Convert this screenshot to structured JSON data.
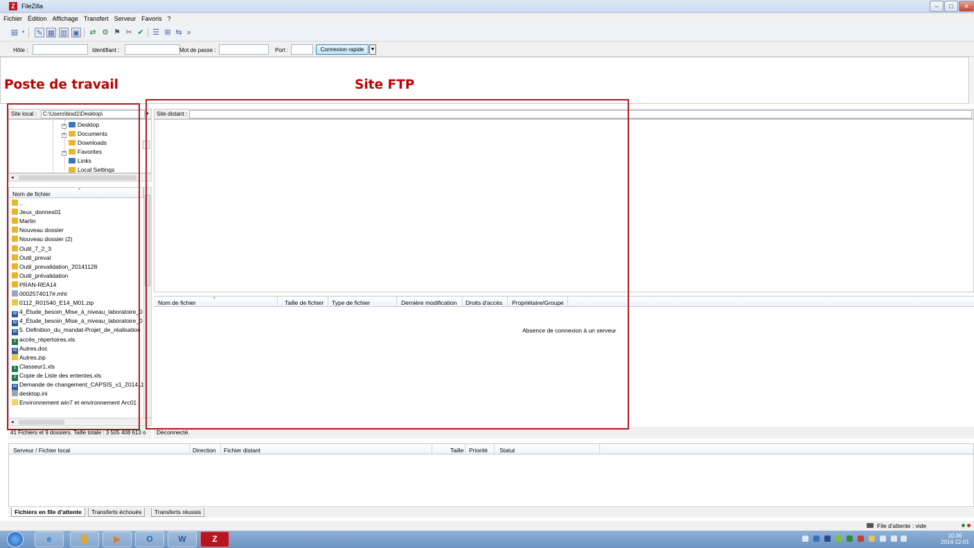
{
  "window": {
    "title": "FileZilla",
    "app_icon": "Z"
  },
  "menu": [
    "Fichier",
    "Édition",
    "Affichage",
    "Transfert",
    "Serveur",
    "Favoris",
    "?"
  ],
  "toolbar_icons": [
    "site-manager-icon",
    "dropdown-icon",
    "toggle-log-icon",
    "toggle-local-tree-icon",
    "toggle-remote-tree-icon",
    "toggle-queue-icon",
    "refresh-icon",
    "process-queue-icon",
    "cancel-icon",
    "disconnect-icon",
    "reconnect-icon",
    "filter-icon",
    "compare-icon",
    "sync-browse-icon",
    "search-icon"
  ],
  "quickconnect": {
    "host_label": "Hôte :",
    "user_label": "Identifiant :",
    "pass_label": "Mot de passe :",
    "port_label": "Port :",
    "button": "Connexion rapide",
    "arrow": "▼"
  },
  "overlays": {
    "local": "Poste de travail",
    "remote": "Site FTP"
  },
  "local": {
    "site_label": "Site local :",
    "path": "C:\\Users\\bisd1\\Desktop\\",
    "tree": [
      {
        "label": "Desktop",
        "expander": "+"
      },
      {
        "label": "Documents",
        "expander": "+"
      },
      {
        "label": "Downloads",
        "expander": ""
      },
      {
        "label": "Favorites",
        "expander": "+"
      },
      {
        "label": "Links",
        "expander": ""
      },
      {
        "label": "Local Settings",
        "expander": ""
      }
    ],
    "column": "Nom de fichier",
    "files": [
      {
        "name": "..",
        "type": "folder"
      },
      {
        "name": "Jeux_donnes01",
        "type": "folder"
      },
      {
        "name": "Martin",
        "type": "folder"
      },
      {
        "name": "Nouveau dossier",
        "type": "folder"
      },
      {
        "name": "Nouveau dossier (2)",
        "type": "folder"
      },
      {
        "name": "Outil_7_2_3",
        "type": "folder"
      },
      {
        "name": "Outil_preval",
        "type": "folder"
      },
      {
        "name": "Outil_prevalidation_20141128",
        "type": "folder"
      },
      {
        "name": "Outil_prévalidation",
        "type": "folder"
      },
      {
        "name": "PRAN-REA14",
        "type": "folder"
      },
      {
        "name": "0002574017#.mht",
        "type": "doc"
      },
      {
        "name": "0112_R01540_E14_M01.zip",
        "type": "zip"
      },
      {
        "name": "4_Étude_besoin_Mise_à_niveau_laboratoire_0",
        "type": "word"
      },
      {
        "name": "4_Étude_besoin_Mise_à_niveau_laboratoire_0",
        "type": "word"
      },
      {
        "name": "5. Definition_du_mandat-Projet_de_réalisation",
        "type": "word"
      },
      {
        "name": "accès_répertoires.xls",
        "type": "excel"
      },
      {
        "name": "Autres.doc",
        "type": "word"
      },
      {
        "name": "Autres.zip",
        "type": "zip"
      },
      {
        "name": "Classeur1.xls",
        "type": "excel"
      },
      {
        "name": "Copie de Liste des ententes.xls",
        "type": "excel"
      },
      {
        "name": "Demande de changement_CAPSIS_v1_201411",
        "type": "word"
      },
      {
        "name": "desktop.ini",
        "type": "doc"
      },
      {
        "name": "Environnement win7 et environnement Arc01",
        "type": "lnk"
      }
    ],
    "status": "41 Fichiers et 9 dossiers. Taille totale : 3 505 408 613 o"
  },
  "remote": {
    "site_label": "Site distant :",
    "columns": [
      "Nom de fichier",
      "Taille de fichier",
      "Type de fichier",
      "Dernière modification",
      "Droits d'accès",
      "Propriétaire/Groupe"
    ],
    "empty_message": "Absence de connexion à un serveur",
    "status": "Déconnecté."
  },
  "queue": {
    "columns": [
      "Serveur / Fichier local",
      "Direction",
      "Fichier distant",
      "Taille",
      "Priorité",
      "Statut"
    ],
    "tabs": [
      "Fichiers en file d'attente",
      "Transferts échoués",
      "Transferts réussis"
    ],
    "status": "File d'attente : vide"
  },
  "taskbar": {
    "apps": [
      "start-orb-icon",
      "ie-icon",
      "explorer-icon",
      "media-icon",
      "outlook-icon",
      "word-icon",
      "filezilla-icon"
    ],
    "time": "10:36",
    "date": "2014-12-01"
  },
  "colors": {
    "accent_red": "#b1161c",
    "overlay_text": "#c00000",
    "taskbar": "#7aa0cc"
  }
}
